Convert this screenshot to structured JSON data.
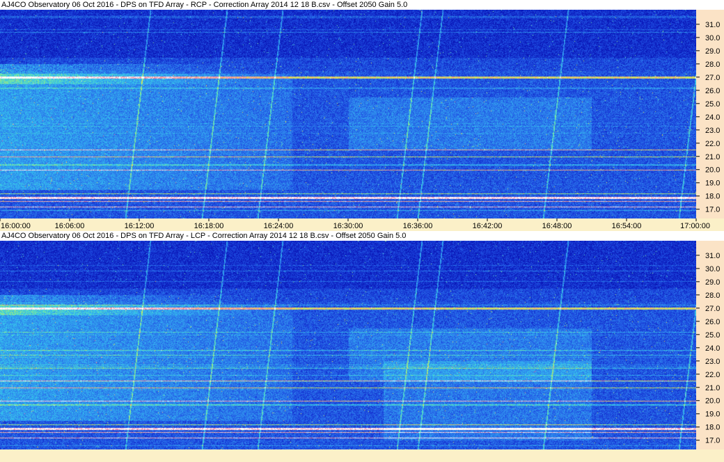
{
  "chart_data": [
    {
      "type": "heatmap",
      "title": "AJ4CO Observatory 06 Oct 2016 - DPS on TFD Array - RCP - Correction Array 2014 12 18 B.csv - Offset 2050  Gain 5.0",
      "x_ticks": [
        "16:00:00",
        "16:06:00",
        "16:12:00",
        "16:18:00",
        "16:24:00",
        "16:30:00",
        "16:36:00",
        "16:42:00",
        "16:48:00",
        "16:54:00",
        "17:00:00"
      ],
      "y_ticks": [
        "17.0",
        "18.0",
        "19.0",
        "20.0",
        "21.0",
        "22.0",
        "23.0",
        "24.0",
        "25.0",
        "26.0",
        "27.0",
        "28.0",
        "29.0",
        "30.0",
        "31.0"
      ],
      "xlim": [
        "16:00:00",
        "17:00:00"
      ],
      "ylim": [
        16.3,
        32.1
      ],
      "colormap": [
        "#0a17b8",
        "#1d49e0",
        "#2f86ee",
        "#34c3ee",
        "#6ee8a8",
        "#e8e84a",
        "#f07aa0",
        "#ffffff"
      ]
    },
    {
      "type": "heatmap",
      "title": "AJ4CO Observatory 06 Oct 2016 - DPS on TFD Array - LCP - Correction Array 2014 12 18 B.csv - Offset 2050  Gain 5.0",
      "y_ticks": [
        "17.0",
        "18.0",
        "19.0",
        "20.0",
        "21.0",
        "22.0",
        "23.0",
        "24.0",
        "25.0",
        "26.0",
        "27.0",
        "28.0",
        "29.0",
        "30.0",
        "31.0"
      ],
      "xlim": [
        "16:00:00",
        "17:00:00"
      ],
      "ylim": [
        16.3,
        32.1
      ],
      "colormap": [
        "#0a17b8",
        "#1d49e0",
        "#2f86ee",
        "#34c3ee",
        "#6ee8a8",
        "#e8e84a",
        "#f07aa0",
        "#ffffff"
      ]
    }
  ]
}
